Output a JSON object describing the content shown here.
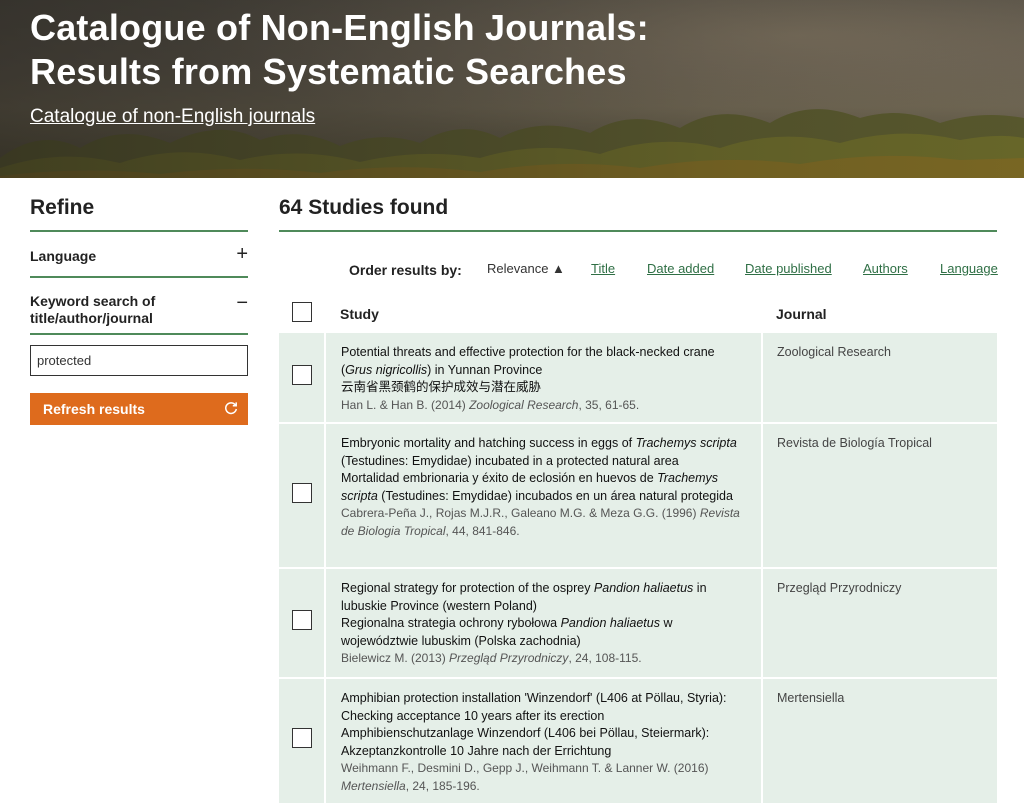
{
  "hero": {
    "title_line1": "Catalogue of Non-English Journals:",
    "title_line2": "Results from Systematic Searches",
    "link": "Catalogue of non-English journals"
  },
  "sidebar": {
    "title": "Refine",
    "language_label": "Language",
    "language_toggle": "+",
    "keyword_label": "Keyword search of title/author/journal",
    "keyword_toggle": "−",
    "keyword_value": "protected",
    "refresh_label": "Refresh results",
    "refresh_icon": "refresh-icon"
  },
  "main": {
    "count": "64 Studies found",
    "order_label": "Order results by:",
    "order_options": [
      "Relevance ▲",
      "Title",
      "Date added",
      "Date published",
      "Authors",
      "Language"
    ],
    "columns": {
      "study": "Study",
      "journal": "Journal"
    },
    "rows": [
      {
        "title_parts": [
          "Potential threats and effective protection for the black-necked crane (",
          "Grus nigricollis",
          ") in Yunnan Province"
        ],
        "translation": "云南省黑颈鹤的保护成效与潜在威胁",
        "cite_authors": "Han L. & Han B. (2014) ",
        "cite_journal": "Zoological Research",
        "cite_rest": ", 35, 61-65.",
        "journal": "Zoological Research"
      },
      {
        "title_parts": [
          "Embryonic mortality and hatching success in eggs of ",
          "Trachemys scripta",
          " (Testudines: Emydidae) incubated in a protected natural area"
        ],
        "translation_parts": [
          "Mortalidad embrionaria y éxito de eclosión en huevos de ",
          "Trachemys scripta",
          " (Testudines: Emydidae) incubados en un área natural protegida"
        ],
        "cite_authors": "Cabrera-Peña J., Rojas M.J.R., Galeano M.G. & Meza G.G. (1996) ",
        "cite_journal": "Revista de Biologia Tropical",
        "cite_rest": ", 44, 841-846.",
        "journal": "Revista de Biología Tropical"
      },
      {
        "title_parts": [
          "Regional strategy for protection of the osprey ",
          "Pandion haliaetus",
          " in lubuskie Province (western Poland)"
        ],
        "translation_parts": [
          "Regionalna strategia ochrony rybołowa ",
          "Pandion haliaetus",
          " w województwie lubuskim (Polska zachodnia)"
        ],
        "cite_authors": "Bielewicz M. (2013) ",
        "cite_journal": "Przegląd Przyrodniczy",
        "cite_rest": ", 24, 108-115.",
        "journal": "Przegląd Przyrodniczy"
      },
      {
        "title": "Amphibian protection installation 'Winzendorf' (L406 at Pöllau, Styria): Checking acceptance 10 years after its erection",
        "translation": "Amphibienschutzanlage Winzendorf (L406 bei Pöllau, Steiermark): Akzeptanzkontrolle 10 Jahre nach der Errichtung",
        "cite_authors": "Weihmann F., Desmini D., Gepp J., Weihmann T. & Lanner W. (2016) ",
        "cite_journal": "Mertensiella",
        "cite_rest": ", 24, 185-196.",
        "journal": "Mertensiella"
      }
    ]
  },
  "colors": {
    "accent_green": "#4f8a5a",
    "button_orange": "#de6b1d",
    "row_bg": "#e5efe8"
  }
}
